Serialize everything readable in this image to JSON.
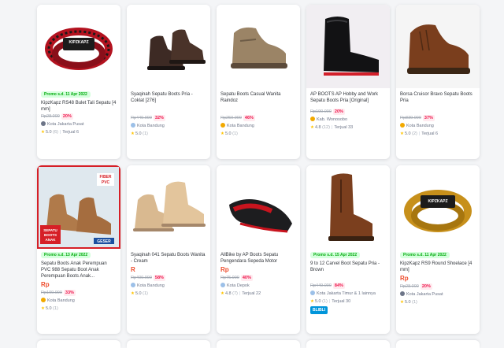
{
  "products": [
    {
      "promo": "Promo s.d. 11 Apr 2022",
      "name": "KipzKapz RS48 Bulet Tali Sepatu [4 mm]",
      "price": "",
      "old_price": "Rp28.000",
      "discount": "20%",
      "shop_badge": "Kota Jakarta Pusat",
      "rating": "5.0",
      "reviews": "(6)",
      "sold": "Terjual 6",
      "image": "red-black-shoelace"
    },
    {
      "promo": "",
      "name": "Syaqinah Sepatu Boots Pria - Coklat [276]",
      "price": "",
      "old_price": "Rp449.000",
      "discount": "32%",
      "shop_badge": "Kota Bandung",
      "rating": "5.0",
      "reviews": "(1)",
      "sold": "",
      "image": "dark-brown-boot"
    },
    {
      "promo": "",
      "name": "Sepatu Boots Casual Wanita Raindoz",
      "price": "",
      "old_price": "Rp250.000",
      "discount": "46%",
      "shop_badge": "Kota Bandung",
      "rating": "5.0",
      "reviews": "(1)",
      "sold": "",
      "image": "khaki-boot"
    },
    {
      "promo": "",
      "name": "AP BOOTS AP Hobby and Work Sepatu Boots Pria [Original]",
      "price": "",
      "old_price": "Rp190.000",
      "discount": "20%",
      "shop_badge": "Kab. Wonosobo",
      "rating": "4.8",
      "reviews": "(12)",
      "sold": "Terjual 33",
      "image": "black-rain-boot"
    },
    {
      "promo": "",
      "name": "Borsa Cruisor Bravo Sepatu Boots Pria",
      "price": "",
      "old_price": "Rp839.000",
      "discount": "37%",
      "shop_badge": "Kota Bandung",
      "rating": "5.0",
      "reviews": "(2)",
      "sold": "Terjual 6",
      "image": "brown-leather-boot"
    },
    {
      "promo": "Promo s.d. 13 Apr 2022",
      "name": "Sepatu Boots Anak Perempuan PVC 988 Sepatu Boot Anak Perempuan Boots Anak...",
      "price": "Rp",
      "old_price": "Rp100.000",
      "discount": "33%",
      "shop_badge": "Kota Bandung",
      "rating": "5.0",
      "reviews": "(1)",
      "sold": "",
      "image": "kids-boots-banner",
      "banner_top": "FIBER PVC",
      "banner_bottom": "SEPATU BOOTS ANAK",
      "banner_side": "GESER"
    },
    {
      "promo": "",
      "name": "Syaqinah 041 Sepatu Boots Wanita - Cream",
      "price": "R",
      "old_price": "Rp400.000",
      "discount": "58%",
      "shop_badge": "Kota Bandung",
      "rating": "5.0",
      "reviews": "(1)",
      "sold": "",
      "image": "cream-boots"
    },
    {
      "promo": "",
      "name": "AllBike by AP Boots Sepatu Pengendara Sepeda Motor",
      "price": "Rp",
      "old_price": "Rp75.000",
      "discount": "40%",
      "shop_badge": "Kota Depok",
      "rating": "4.8",
      "reviews": "(7)",
      "sold": "Terjual 22",
      "image": "red-black-moto-boot"
    },
    {
      "promo": "Promo s.d. 15 Apr 2022",
      "name": "9 to 12 Carvel Boot Sepatu Pria - Brown",
      "price": "",
      "old_price": "Rp449.000",
      "discount": "84%",
      "shop_badge": "Kota Jakarta Timur & 1 lainnya",
      "rating": "5.0",
      "reviews": "(1)",
      "sold": "Terjual 30",
      "image": "brown-brogue-boot",
      "store_logo": "BLIBLI"
    },
    {
      "promo": "Promo s.d. 11 Apr 2022",
      "name": "KipzKapz RS9 Round Shoelace [4 mm]",
      "price": "Rp",
      "old_price": "Rp28.000",
      "discount": "20%",
      "shop_badge": "Kota Jakarta Pusat",
      "rating": "5.0",
      "reviews": "(1)",
      "sold": "",
      "image": "yellow-shoelace"
    }
  ],
  "colors": {
    "promo_green": "#03ac0e",
    "discount_red": "#ef144a",
    "star": "#ffc400"
  },
  "shoelace_brand": "KIPZKAPZ"
}
